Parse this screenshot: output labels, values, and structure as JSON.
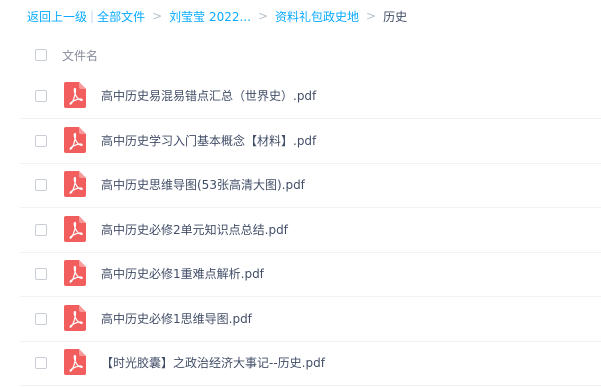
{
  "breadcrumb": {
    "back": "返回上一级",
    "separator_bar": "|",
    "all_files": "全部文件",
    "level1": "刘莹莹 2022...",
    "level2": "资料礼包政史地",
    "current": "历史",
    "arrow": ">"
  },
  "header": {
    "name_label": "文件名"
  },
  "files": [
    {
      "name": "高中历史易混易错点汇总（世界史）.pdf",
      "icon": "pdf-icon"
    },
    {
      "name": "高中历史学习入门基本概念【材料】.pdf",
      "icon": "pdf-icon"
    },
    {
      "name": "高中历史思维导图(53张高清大图).pdf",
      "icon": "pdf-icon"
    },
    {
      "name": "高中历史必修2单元知识点总结.pdf",
      "icon": "pdf-icon"
    },
    {
      "name": "高中历史必修1重难点解析.pdf",
      "icon": "pdf-icon"
    },
    {
      "name": "高中历史必修1思维导图.pdf",
      "icon": "pdf-icon"
    },
    {
      "name": "【时光胶囊】之政治经济大事记--历史.pdf",
      "icon": "pdf-icon"
    }
  ],
  "colors": {
    "link": "#09aaff",
    "pdf_red": "#f25e5e",
    "text": "#424e67"
  }
}
